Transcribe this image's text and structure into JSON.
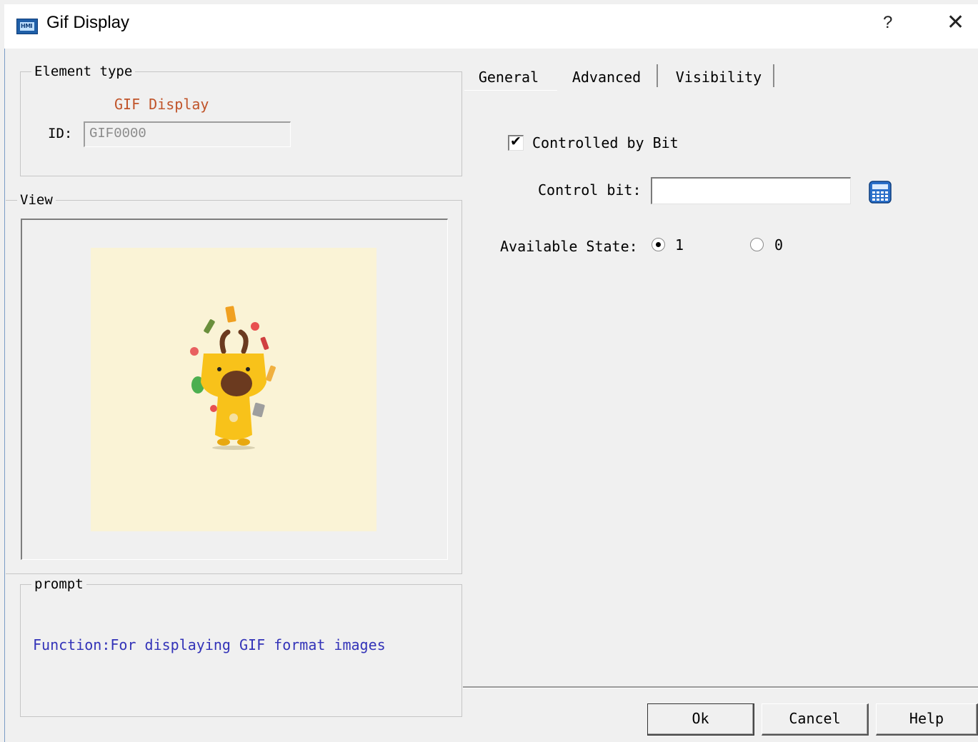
{
  "window": {
    "title": "Gif Display",
    "help_glyph": "?",
    "close_glyph": "✕",
    "icon_text": "HMI"
  },
  "element_type": {
    "legend": "Element type",
    "name": "GIF Display",
    "id_label": "ID:",
    "id_value": "GIF0000"
  },
  "view": {
    "legend": "View"
  },
  "prompt": {
    "legend": "prompt",
    "text": "Function:For displaying GIF format images"
  },
  "tabs": [
    {
      "label": "General",
      "selected": false
    },
    {
      "label": "Advanced",
      "selected": true
    },
    {
      "label": "Visibility",
      "selected": false
    }
  ],
  "advanced": {
    "controlled_by_bit": {
      "label": "Controlled by Bit",
      "checked": true
    },
    "control_bit": {
      "label": "Control bit:",
      "value": ""
    },
    "available_state": {
      "label": "Available State:",
      "options": [
        {
          "label": "1",
          "selected": true
        },
        {
          "label": "0",
          "selected": false
        }
      ]
    }
  },
  "buttons": {
    "ok": "Ok",
    "cancel": "Cancel",
    "help": "Help"
  },
  "colors": {
    "element_name": "#c0542a",
    "prompt_text": "#3333b8",
    "gif_background": "#faf3d6"
  }
}
